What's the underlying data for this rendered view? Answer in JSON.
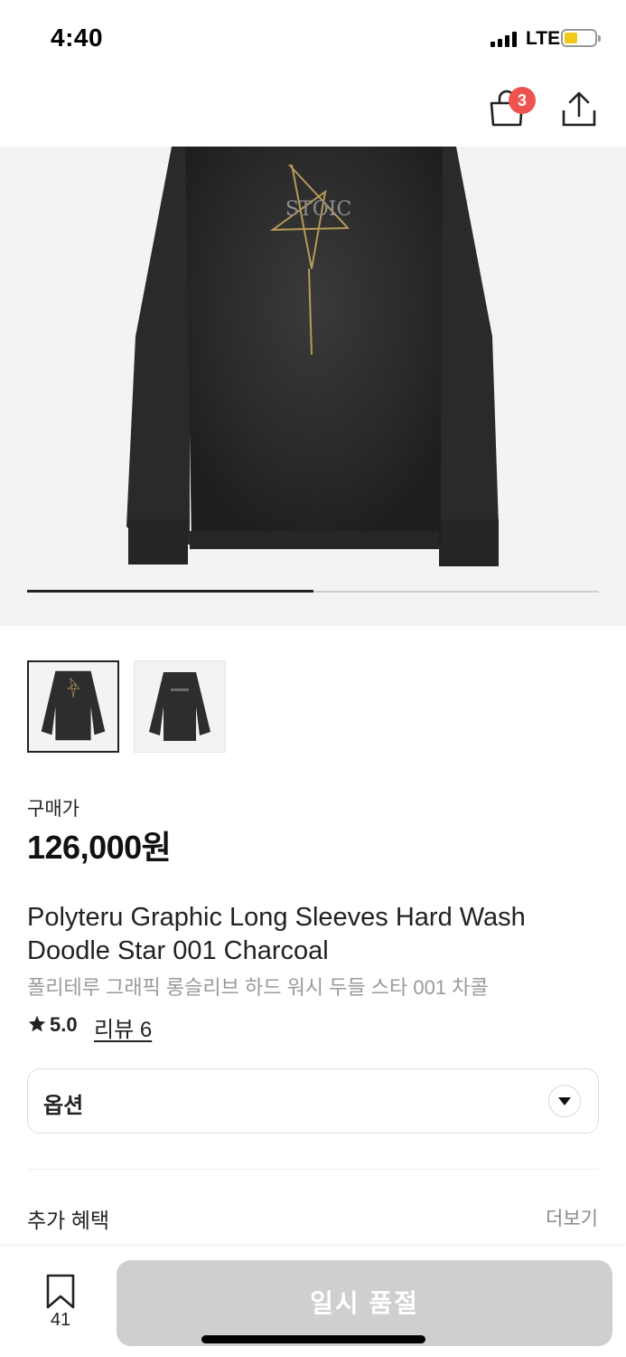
{
  "status_bar": {
    "time": "4:40",
    "network": "LTE"
  },
  "header": {
    "cart_badge": "3",
    "icons": [
      "shopping-bag-icon",
      "share-icon"
    ]
  },
  "gallery": {
    "current_index": 1,
    "total_images": 2,
    "progress_fraction": 0.5,
    "print_text": "STOIC"
  },
  "product": {
    "price_label": "구매가",
    "price": "126,000원",
    "name_en": "Polyteru Graphic Long Sleeves Hard Wash Doodle Star 001 Charcoal",
    "name_ko": "폴리테루 그래픽 롱슬리브 하드 워시 두들 스타 001 차콜",
    "rating": "5.0",
    "review_link": "리뷰 6"
  },
  "option": {
    "label": "옵션"
  },
  "benefits": {
    "title": "추가 혜택",
    "more": "더보기"
  },
  "bottom_bar": {
    "bookmark_count": "41",
    "action_label": "일시 품절"
  },
  "colors": {
    "badge": "#ef5350",
    "soldout_bg": "#cfcfcf",
    "gallery_bg": "#f3f3f3"
  }
}
